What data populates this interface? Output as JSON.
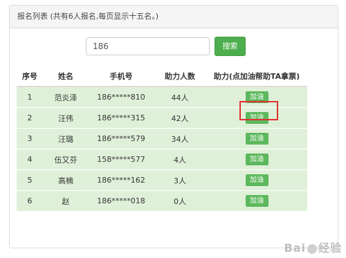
{
  "panel": {
    "heading": "报名列表 (共有6人报名,每页显示十五名。)"
  },
  "search": {
    "value": "186",
    "button_label": "搜索"
  },
  "table": {
    "headers": [
      "序号",
      "姓名",
      "手机号",
      "助力人数",
      "助力(点加油帮助TA拿票)"
    ],
    "rows": [
      {
        "index": "1",
        "name": "范炎泽",
        "phone": "186*****810",
        "boost_count": "44人",
        "action_label": "加油"
      },
      {
        "index": "2",
        "name": "汪伟",
        "phone": "186*****315",
        "boost_count": "42人",
        "action_label": "加油"
      },
      {
        "index": "3",
        "name": "汪璐",
        "phone": "186*****579",
        "boost_count": "34人",
        "action_label": "加油"
      },
      {
        "index": "4",
        "name": "伍又芬",
        "phone": "158*****577",
        "boost_count": "4人",
        "action_label": "加油"
      },
      {
        "index": "5",
        "name": "高楠",
        "phone": "186*****162",
        "boost_count": "3人",
        "action_label": "加油"
      },
      {
        "index": "6",
        "name": "赵",
        "phone": "186*****018",
        "boost_count": "0人",
        "action_label": "加油"
      }
    ]
  },
  "watermark": {
    "text_left": "Bai",
    "text_right": "经验"
  },
  "colors": {
    "row_background": "#dff0d8",
    "button_green": "#5cb85c",
    "highlight_red": "#e03030"
  }
}
